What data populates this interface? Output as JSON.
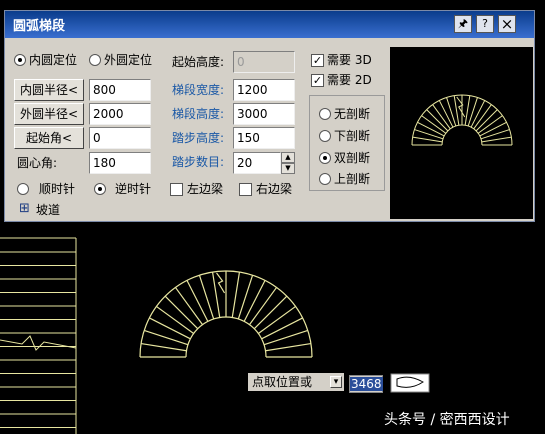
{
  "dialog": {
    "title": "圆弧梯段",
    "icons": [
      "pin-icon",
      "help-icon",
      "close-icon"
    ],
    "pin_glyph": "🖈",
    "help_glyph": "?",
    "close_glyph": "×",
    "position_options": [
      {
        "label": "内圆定位",
        "selected": true
      },
      {
        "label": "外圆定位",
        "selected": false
      }
    ],
    "inner_radius_button": "内圆半径<",
    "inner_radius": "800",
    "outer_radius_button": "外圆半径<",
    "outer_radius": "2000",
    "start_angle_button": "起始角<",
    "start_angle": "0",
    "center_angle_label": "圆心角:",
    "center_angle": "180",
    "start_height_label": "起始高度:",
    "start_height": "0",
    "stair_width_label": "梯段宽度:",
    "stair_width": "1200",
    "stair_height_label": "梯段高度:",
    "stair_height": "3000",
    "step_height_label": "踏步高度:",
    "step_height": "150",
    "step_count_label": "踏步数目:",
    "step_count": "20",
    "direction_options": [
      {
        "label": "顺时针",
        "selected": false
      },
      {
        "label": "逆时针",
        "selected": true
      }
    ],
    "left_beam_label": "左边梁",
    "left_beam_checked": false,
    "right_beam_label": "右边梁",
    "right_beam_checked": false,
    "ramp_expand_glyph": "⊞",
    "ramp_label": "坡道",
    "need_3d_label": "需要 3D",
    "need_3d_checked": true,
    "need_2d_label": "需要 2D",
    "need_2d_checked": true,
    "check_glyph": "✓",
    "section_options": [
      {
        "label": "无剖断",
        "selected": false
      },
      {
        "label": "下剖断",
        "selected": false
      },
      {
        "label": "双剖断",
        "selected": true
      },
      {
        "label": "上剖断",
        "selected": false
      }
    ]
  },
  "command_bar": {
    "prompt": "点取位置或",
    "dropdown_glyph": "▾",
    "value": "3468"
  },
  "watermark": "头条号 / 密西西设计",
  "colors": {
    "drawing_line": "#e8e6a0",
    "background": "#000000",
    "title_bar": "#0a3c8c",
    "dialog_face": "#d4d0c8",
    "label_blue": "#1a58a6"
  }
}
